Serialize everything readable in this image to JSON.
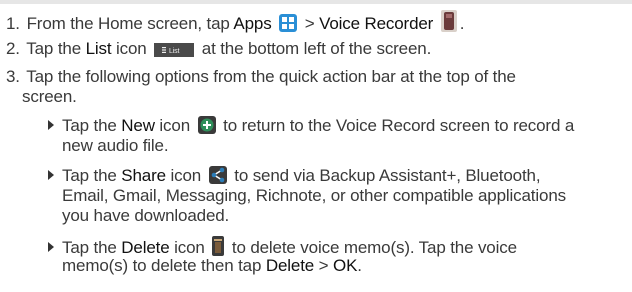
{
  "step1": {
    "num": "1.",
    "a": "From the Home screen, tap ",
    "apps": "Apps",
    "sep": " > ",
    "voice_recorder": "Voice Recorder",
    "end": "."
  },
  "step2": {
    "num": "2.",
    "a": "Tap the ",
    "list": "List",
    "b": " icon",
    "c": " at the bottom left of the screen.",
    "list_icon_text": "List"
  },
  "step3": {
    "num": "3.",
    "line1": "Tap the following options from the quick action bar at the top of the",
    "line2": "screen."
  },
  "bullet_new": {
    "a": "Tap the ",
    "new": "New",
    "b": " icon",
    "c": " to return to the Voice Record screen to record a",
    "line2": "new audio file."
  },
  "bullet_share": {
    "a": "Tap the ",
    "share": "Share",
    "b": " icon",
    "c": " to send via Backup Assistant+, Bluetooth,",
    "line2": "Email, Gmail, Messaging, Richnote, or other compatible applications",
    "line3": "you have downloaded."
  },
  "bullet_delete": {
    "a": "Tap the ",
    "delete": "Delete",
    "b": " icon",
    "c": " to delete voice memo(s). Tap the voice",
    "line2a": "memo(s) to delete then tap ",
    "delete2": "Delete",
    "sep": " > ",
    "ok": "OK",
    "end": "."
  },
  "colors": {
    "apps_icon": "#2a8fd6",
    "recorder_icon": "#6b3b3b",
    "new_icon": "#2f8f5a",
    "share_icon": "#2c7db8",
    "delete_icon": "#7a5b3a"
  }
}
